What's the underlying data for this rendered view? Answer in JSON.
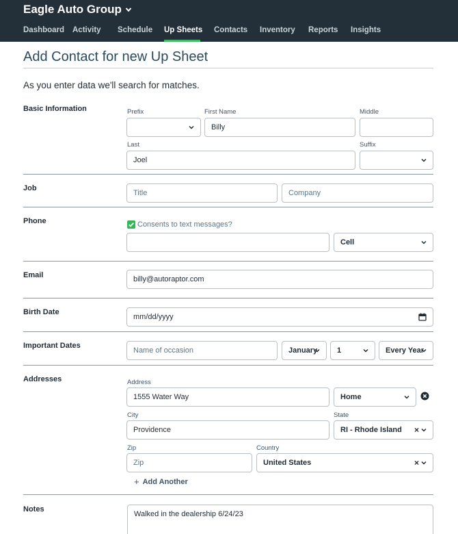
{
  "header": {
    "brand": "Eagle Auto Group",
    "nav": [
      {
        "label": "Dashboard",
        "active": false
      },
      {
        "label": "Activity",
        "active": false
      },
      {
        "label": "Schedule",
        "active": false
      },
      {
        "label": "Up Sheets",
        "active": true
      },
      {
        "label": "Contacts",
        "active": false
      },
      {
        "label": "Inventory",
        "active": false
      },
      {
        "label": "Reports",
        "active": false
      },
      {
        "label": "Insights",
        "active": false
      }
    ]
  },
  "page": {
    "title": "Add Contact for new Up Sheet",
    "intro": "As you enter data we'll search for matches."
  },
  "basic": {
    "section": "Basic Information",
    "prefix_label": "Prefix",
    "prefix_value": "",
    "first_label": "First Name",
    "first_value": "Billy",
    "middle_label": "Middle",
    "middle_value": "",
    "last_label": "Last",
    "last_value": "Joel",
    "suffix_label": "Suffix",
    "suffix_value": ""
  },
  "job": {
    "section": "Job",
    "title_placeholder": "Title",
    "company_placeholder": "Company"
  },
  "phone": {
    "section": "Phone",
    "consent_label": "Consents to text messages?",
    "consent_checked": true,
    "number_value": "",
    "type_value": "Cell"
  },
  "email": {
    "section": "Email",
    "value": "billy@autoraptor.com"
  },
  "birth": {
    "section": "Birth Date",
    "placeholder": "mm/dd/yyyy"
  },
  "dates": {
    "section": "Important Dates",
    "occasion_placeholder": "Name of occasion",
    "month_value": "January",
    "day_value": "1",
    "repeat_value": "Every Year"
  },
  "address": {
    "section": "Addresses",
    "address_label": "Address",
    "address_value": "1555 Water Way",
    "type_value": "Home",
    "city_label": "City",
    "city_value": "Providence",
    "state_label": "State",
    "state_value": "RI - Rhode Island",
    "zip_label": "Zip",
    "zip_placeholder": "Zip",
    "country_label": "Country",
    "country_value": "United States",
    "add_another": "Add Another"
  },
  "notes": {
    "section": "Notes",
    "value": "Walked in the dealership 6/24/23"
  },
  "colors": {
    "header_bg": "#233039",
    "active_tab_underline": "#43b866",
    "checkbox": "#36b65b"
  },
  "icons": {
    "brand_dropdown": "chevron-down-icon",
    "select_caret": "chevron-down-icon",
    "calendar": "calendar-icon",
    "remove_address": "close-circle-icon",
    "consent_checkbox": "check-icon",
    "clear_select": "close-icon",
    "add_another": "plus-icon"
  }
}
